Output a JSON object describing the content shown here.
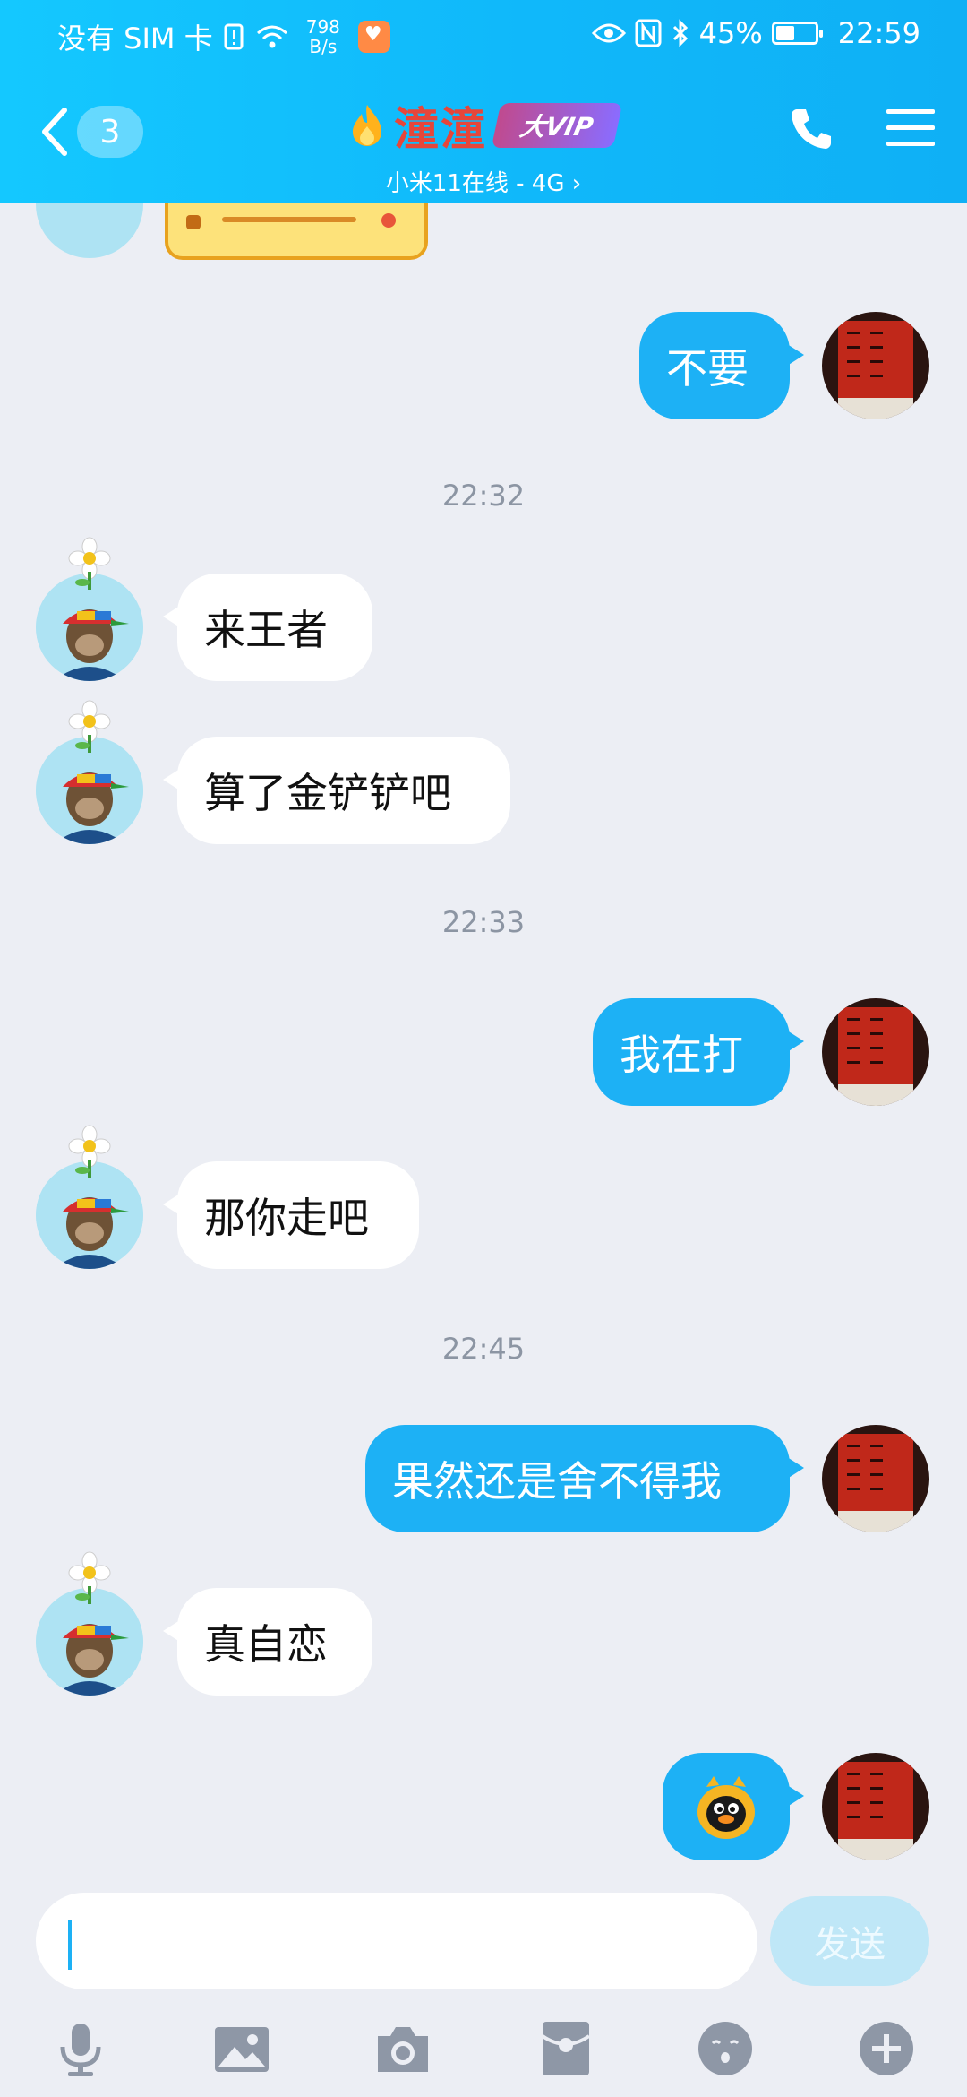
{
  "status_bar": {
    "carrier": "没有 SIM 卡",
    "net_speed_value": "798",
    "net_speed_unit": "B/s",
    "battery": "45%",
    "battery_level": 0.45,
    "time": "22:59"
  },
  "header": {
    "unread_count": "3",
    "contact_name": "潼潼",
    "vip_badge": "大VIP",
    "subtitle": "小米11在线 - 4G",
    "accent_color": "#12baf8",
    "name_color": "#e6463a"
  },
  "messages": [
    {
      "side": "out",
      "text": "不要"
    },
    {
      "timestamp": "22:32"
    },
    {
      "side": "in",
      "text": "来王者"
    },
    {
      "side": "in",
      "text": "算了金铲铲吧"
    },
    {
      "timestamp": "22:33"
    },
    {
      "side": "out",
      "text": "我在打"
    },
    {
      "side": "in",
      "text": "那你走吧"
    },
    {
      "timestamp": "22:45"
    },
    {
      "side": "out",
      "text": "果然还是舍不得我"
    },
    {
      "side": "in",
      "text": "真自恋"
    },
    {
      "side": "out",
      "sticker": "penguin-sticker"
    }
  ],
  "bubble_colors": {
    "outgoing": "#1db1f5",
    "incoming": "#ffffff"
  },
  "composer": {
    "input_value": "",
    "send_label": "发送"
  },
  "toolbar_icons": [
    "microphone-icon",
    "image-icon",
    "camera-icon",
    "red-packet-icon",
    "emoji-icon",
    "plus-icon"
  ]
}
